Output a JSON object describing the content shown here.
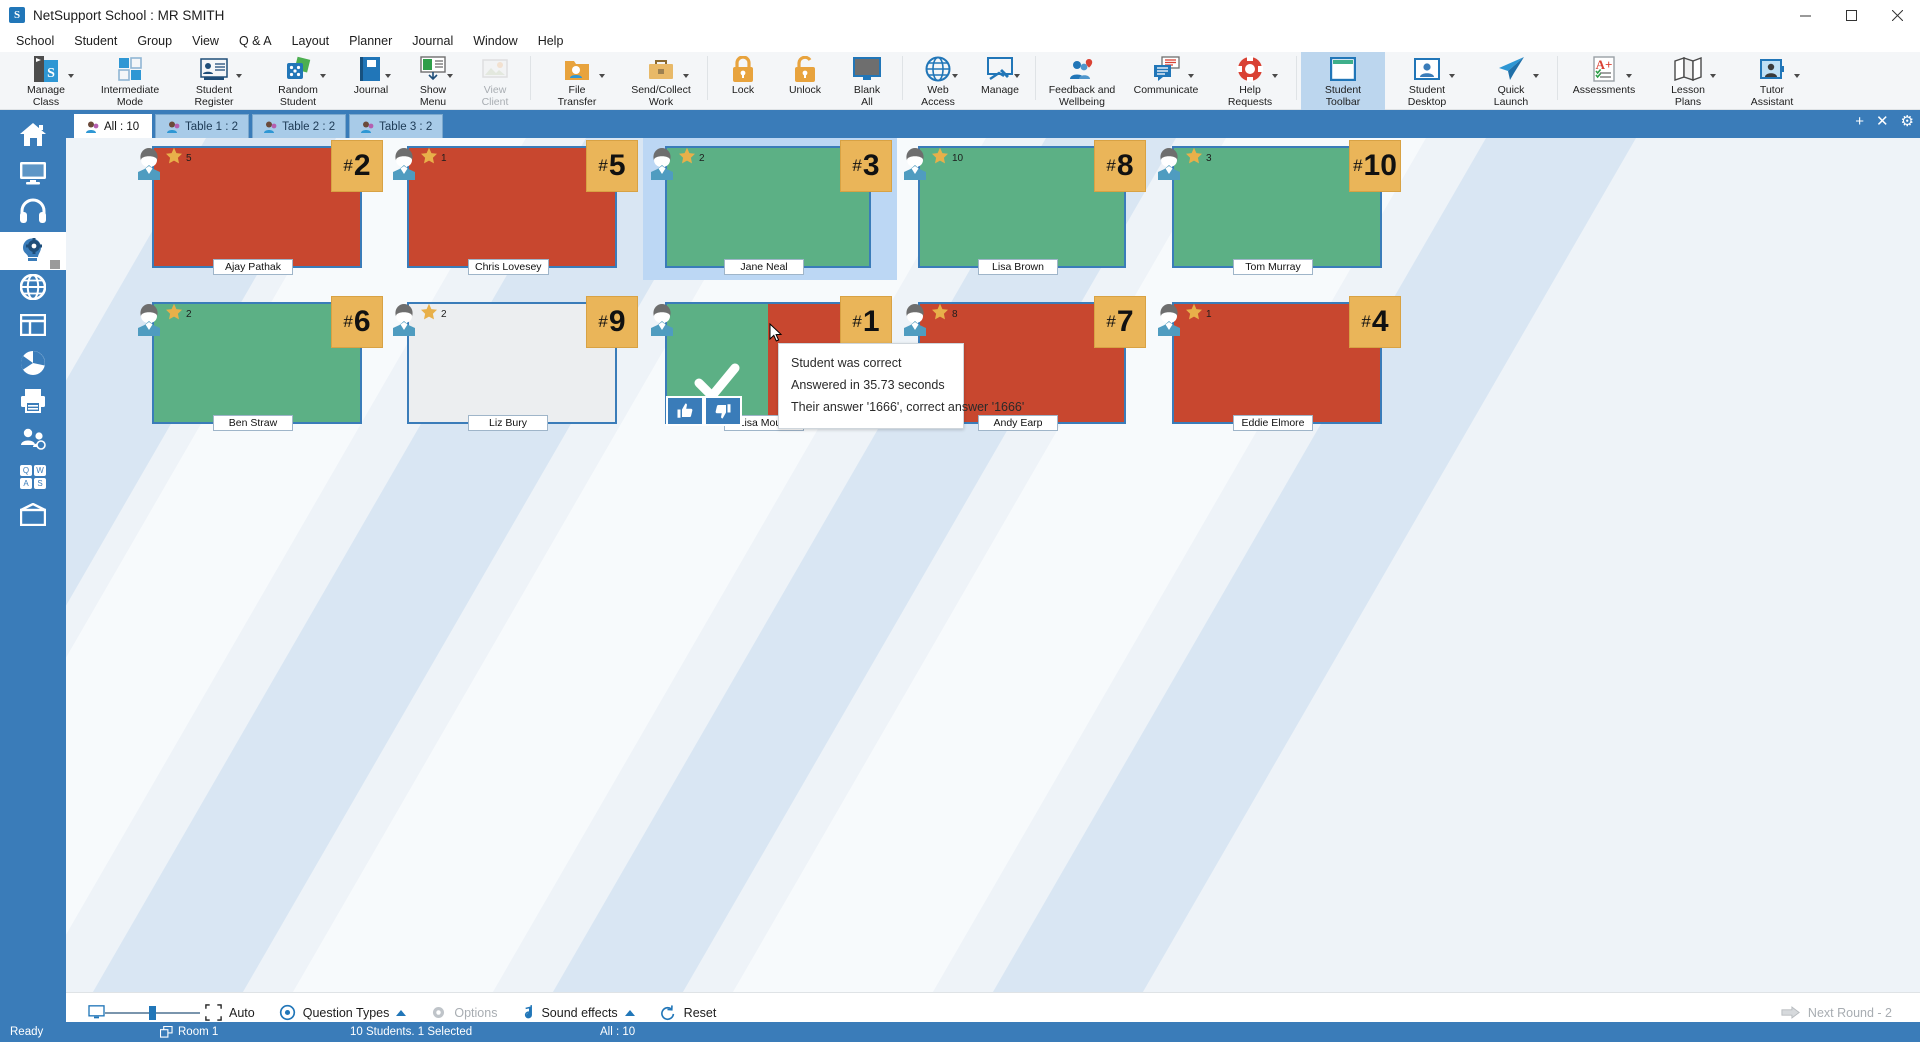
{
  "window": {
    "title": "NetSupport School : MR SMITH",
    "logo_text": "S",
    "minimize": "minimize-icon",
    "maximize": "maximize-icon",
    "close": "close-icon"
  },
  "menubar": {
    "items": [
      {
        "label": "School"
      },
      {
        "label": "Student"
      },
      {
        "label": "Group"
      },
      {
        "label": "View"
      },
      {
        "label": "Q & A"
      },
      {
        "label": "Layout"
      },
      {
        "label": "Planner"
      },
      {
        "label": "Journal"
      },
      {
        "label": "Window"
      },
      {
        "label": "Help"
      }
    ]
  },
  "ribbon": {
    "buttons": [
      {
        "label": "Manage\nClass",
        "icon": "manage-class-icon",
        "caret": true,
        "disabled": false,
        "active": false
      },
      {
        "label": "Intermediate\nMode",
        "icon": "intermediate-mode-icon",
        "caret": false,
        "disabled": false,
        "active": false
      },
      {
        "label": "Student\nRegister",
        "icon": "student-register-icon",
        "caret": true,
        "disabled": false,
        "active": false
      },
      {
        "label": "Random\nStudent",
        "icon": "random-student-icon",
        "caret": true,
        "disabled": false,
        "active": false
      },
      {
        "label": "Journal",
        "icon": "journal-icon",
        "caret": true,
        "disabled": false,
        "active": false
      },
      {
        "label": "Show\nMenu",
        "icon": "show-menu-icon",
        "caret": true,
        "disabled": false,
        "active": false
      },
      {
        "label": "View\nClient",
        "icon": "view-client-icon",
        "caret": false,
        "disabled": true,
        "active": false
      },
      {
        "label": "File\nTransfer",
        "icon": "file-transfer-icon",
        "caret": true,
        "disabled": false,
        "active": false
      },
      {
        "label": "Send/Collect\nWork",
        "icon": "send-collect-work-icon",
        "caret": true,
        "disabled": false,
        "active": false
      },
      {
        "label": "Lock",
        "icon": "lock-icon",
        "caret": false,
        "disabled": false,
        "active": false
      },
      {
        "label": "Unlock",
        "icon": "unlock-icon",
        "caret": false,
        "disabled": false,
        "active": false
      },
      {
        "label": "Blank\nAll",
        "icon": "blank-all-icon",
        "caret": false,
        "disabled": false,
        "active": false
      },
      {
        "label": "Web\nAccess",
        "icon": "web-access-icon",
        "caret": true,
        "disabled": false,
        "active": false
      },
      {
        "label": "Manage",
        "icon": "manage-tools-icon",
        "caret": true,
        "disabled": false,
        "active": false
      },
      {
        "label": "Feedback and\nWellbeing",
        "icon": "feedback-wellbeing-icon",
        "caret": false,
        "disabled": false,
        "active": false
      },
      {
        "label": "Communicate",
        "icon": "communicate-icon",
        "caret": true,
        "disabled": false,
        "active": false
      },
      {
        "label": "Help\nRequests",
        "icon": "help-requests-icon",
        "caret": true,
        "disabled": false,
        "active": false
      },
      {
        "label": "Student\nToolbar",
        "icon": "student-toolbar-icon",
        "caret": false,
        "disabled": false,
        "active": true
      },
      {
        "label": "Student\nDesktop",
        "icon": "student-desktop-icon",
        "caret": true,
        "disabled": false,
        "active": false
      },
      {
        "label": "Quick\nLaunch",
        "icon": "quick-launch-icon",
        "caret": true,
        "disabled": false,
        "active": false
      },
      {
        "label": "Assessments",
        "icon": "assessments-icon",
        "caret": true,
        "disabled": false,
        "active": false
      },
      {
        "label": "Lesson\nPlans",
        "icon": "lesson-plans-icon",
        "caret": true,
        "disabled": false,
        "active": false
      },
      {
        "label": "Tutor\nAssistant",
        "icon": "tutor-assistant-icon",
        "caret": true,
        "disabled": false,
        "active": false
      }
    ]
  },
  "sidebar": {
    "items": [
      {
        "name": "home",
        "icon": "home-icon",
        "active": false
      },
      {
        "name": "monitor",
        "icon": "monitor-icon",
        "active": false
      },
      {
        "name": "audio",
        "icon": "headphones-icon",
        "active": false
      },
      {
        "name": "question",
        "icon": "brain-gear-icon",
        "active": true
      },
      {
        "name": "internet",
        "icon": "globe-icon",
        "active": false
      },
      {
        "name": "application",
        "icon": "window-icon",
        "active": false
      },
      {
        "name": "survey",
        "icon": "pie-chart-icon",
        "active": false
      },
      {
        "name": "print",
        "icon": "printer-icon",
        "active": false
      },
      {
        "name": "group-users",
        "icon": "group-users-icon",
        "active": false
      },
      {
        "name": "keyboard",
        "icon": "keyboard-qwas-icon",
        "active": false
      },
      {
        "name": "layout",
        "icon": "layout-desk-icon",
        "active": false
      }
    ]
  },
  "tabs": {
    "items": [
      {
        "label": "All : 10",
        "active": true
      },
      {
        "label": "Table 1 : 2",
        "active": false
      },
      {
        "label": "Table 2 : 2",
        "active": false
      },
      {
        "label": "Table 3 : 2",
        "active": false
      }
    ],
    "actions": [
      {
        "name": "add-tab",
        "glyph": "+"
      },
      {
        "name": "close-tab",
        "glyph": "✕"
      },
      {
        "name": "tab-settings",
        "glyph": "⚙"
      }
    ]
  },
  "students": [
    {
      "name": "Ajay Pathak",
      "number": "2",
      "stars": "5",
      "state": "red",
      "selected": false,
      "row": 0,
      "col": 0
    },
    {
      "name": "Chris Lovesey",
      "number": "5",
      "stars": "1",
      "state": "red",
      "selected": false,
      "row": 0,
      "col": 1
    },
    {
      "name": "Jane Neal",
      "number": "3",
      "stars": "2",
      "state": "green",
      "selected": true,
      "row": 0,
      "col": 2
    },
    {
      "name": "Lisa Brown",
      "number": "8",
      "stars": "10",
      "state": "green",
      "selected": false,
      "row": 0,
      "col": 3
    },
    {
      "name": "Tom Murray",
      "number": "10",
      "stars": "3",
      "state": "green",
      "selected": false,
      "row": 0,
      "col": 4
    },
    {
      "name": "Ben Straw",
      "number": "6",
      "stars": "2",
      "state": "green",
      "selected": false,
      "row": 1,
      "col": 0
    },
    {
      "name": "Liz Bury",
      "number": "9",
      "stars": "2",
      "state": "grey",
      "selected": false,
      "row": 1,
      "col": 1
    },
    {
      "name": "Lisa Moule",
      "number": "1",
      "stars": "",
      "state": "split",
      "selected": false,
      "row": 1,
      "col": 2
    },
    {
      "name": "Andy Earp",
      "number": "7",
      "stars": "8",
      "state": "red",
      "selected": false,
      "row": 1,
      "col": 3
    },
    {
      "name": "Eddie Elmore",
      "number": "4",
      "stars": "1",
      "state": "red",
      "selected": false,
      "row": 1,
      "col": 4
    }
  ],
  "tooltip": {
    "line1": "Student was correct",
    "line2": "Answered in 35.73 seconds",
    "line3": "Their answer '1666', correct answer '1666'"
  },
  "verdict": {
    "thumbs_up": "thumbs-up-icon",
    "thumbs_down": "thumbs-down-icon",
    "correct_mark": "check-icon",
    "incorrect_mark": "cross-icon"
  },
  "bottombar": {
    "auto_label": "Auto",
    "question_types_label": "Question Types",
    "options_label": "Options",
    "sound_effects_label": "Sound effects",
    "reset_label": "Reset",
    "next_round_label": "Next Round - 2"
  },
  "statusbar": {
    "ready": "Ready",
    "room": "Room 1",
    "students": "10 Students. 1 Selected",
    "group": "All : 10"
  },
  "colors": {
    "accent": "#3a7cb9",
    "red": "#c8472f",
    "green": "#5cb085",
    "amber": "#eab559",
    "grey": "#eceef0"
  }
}
